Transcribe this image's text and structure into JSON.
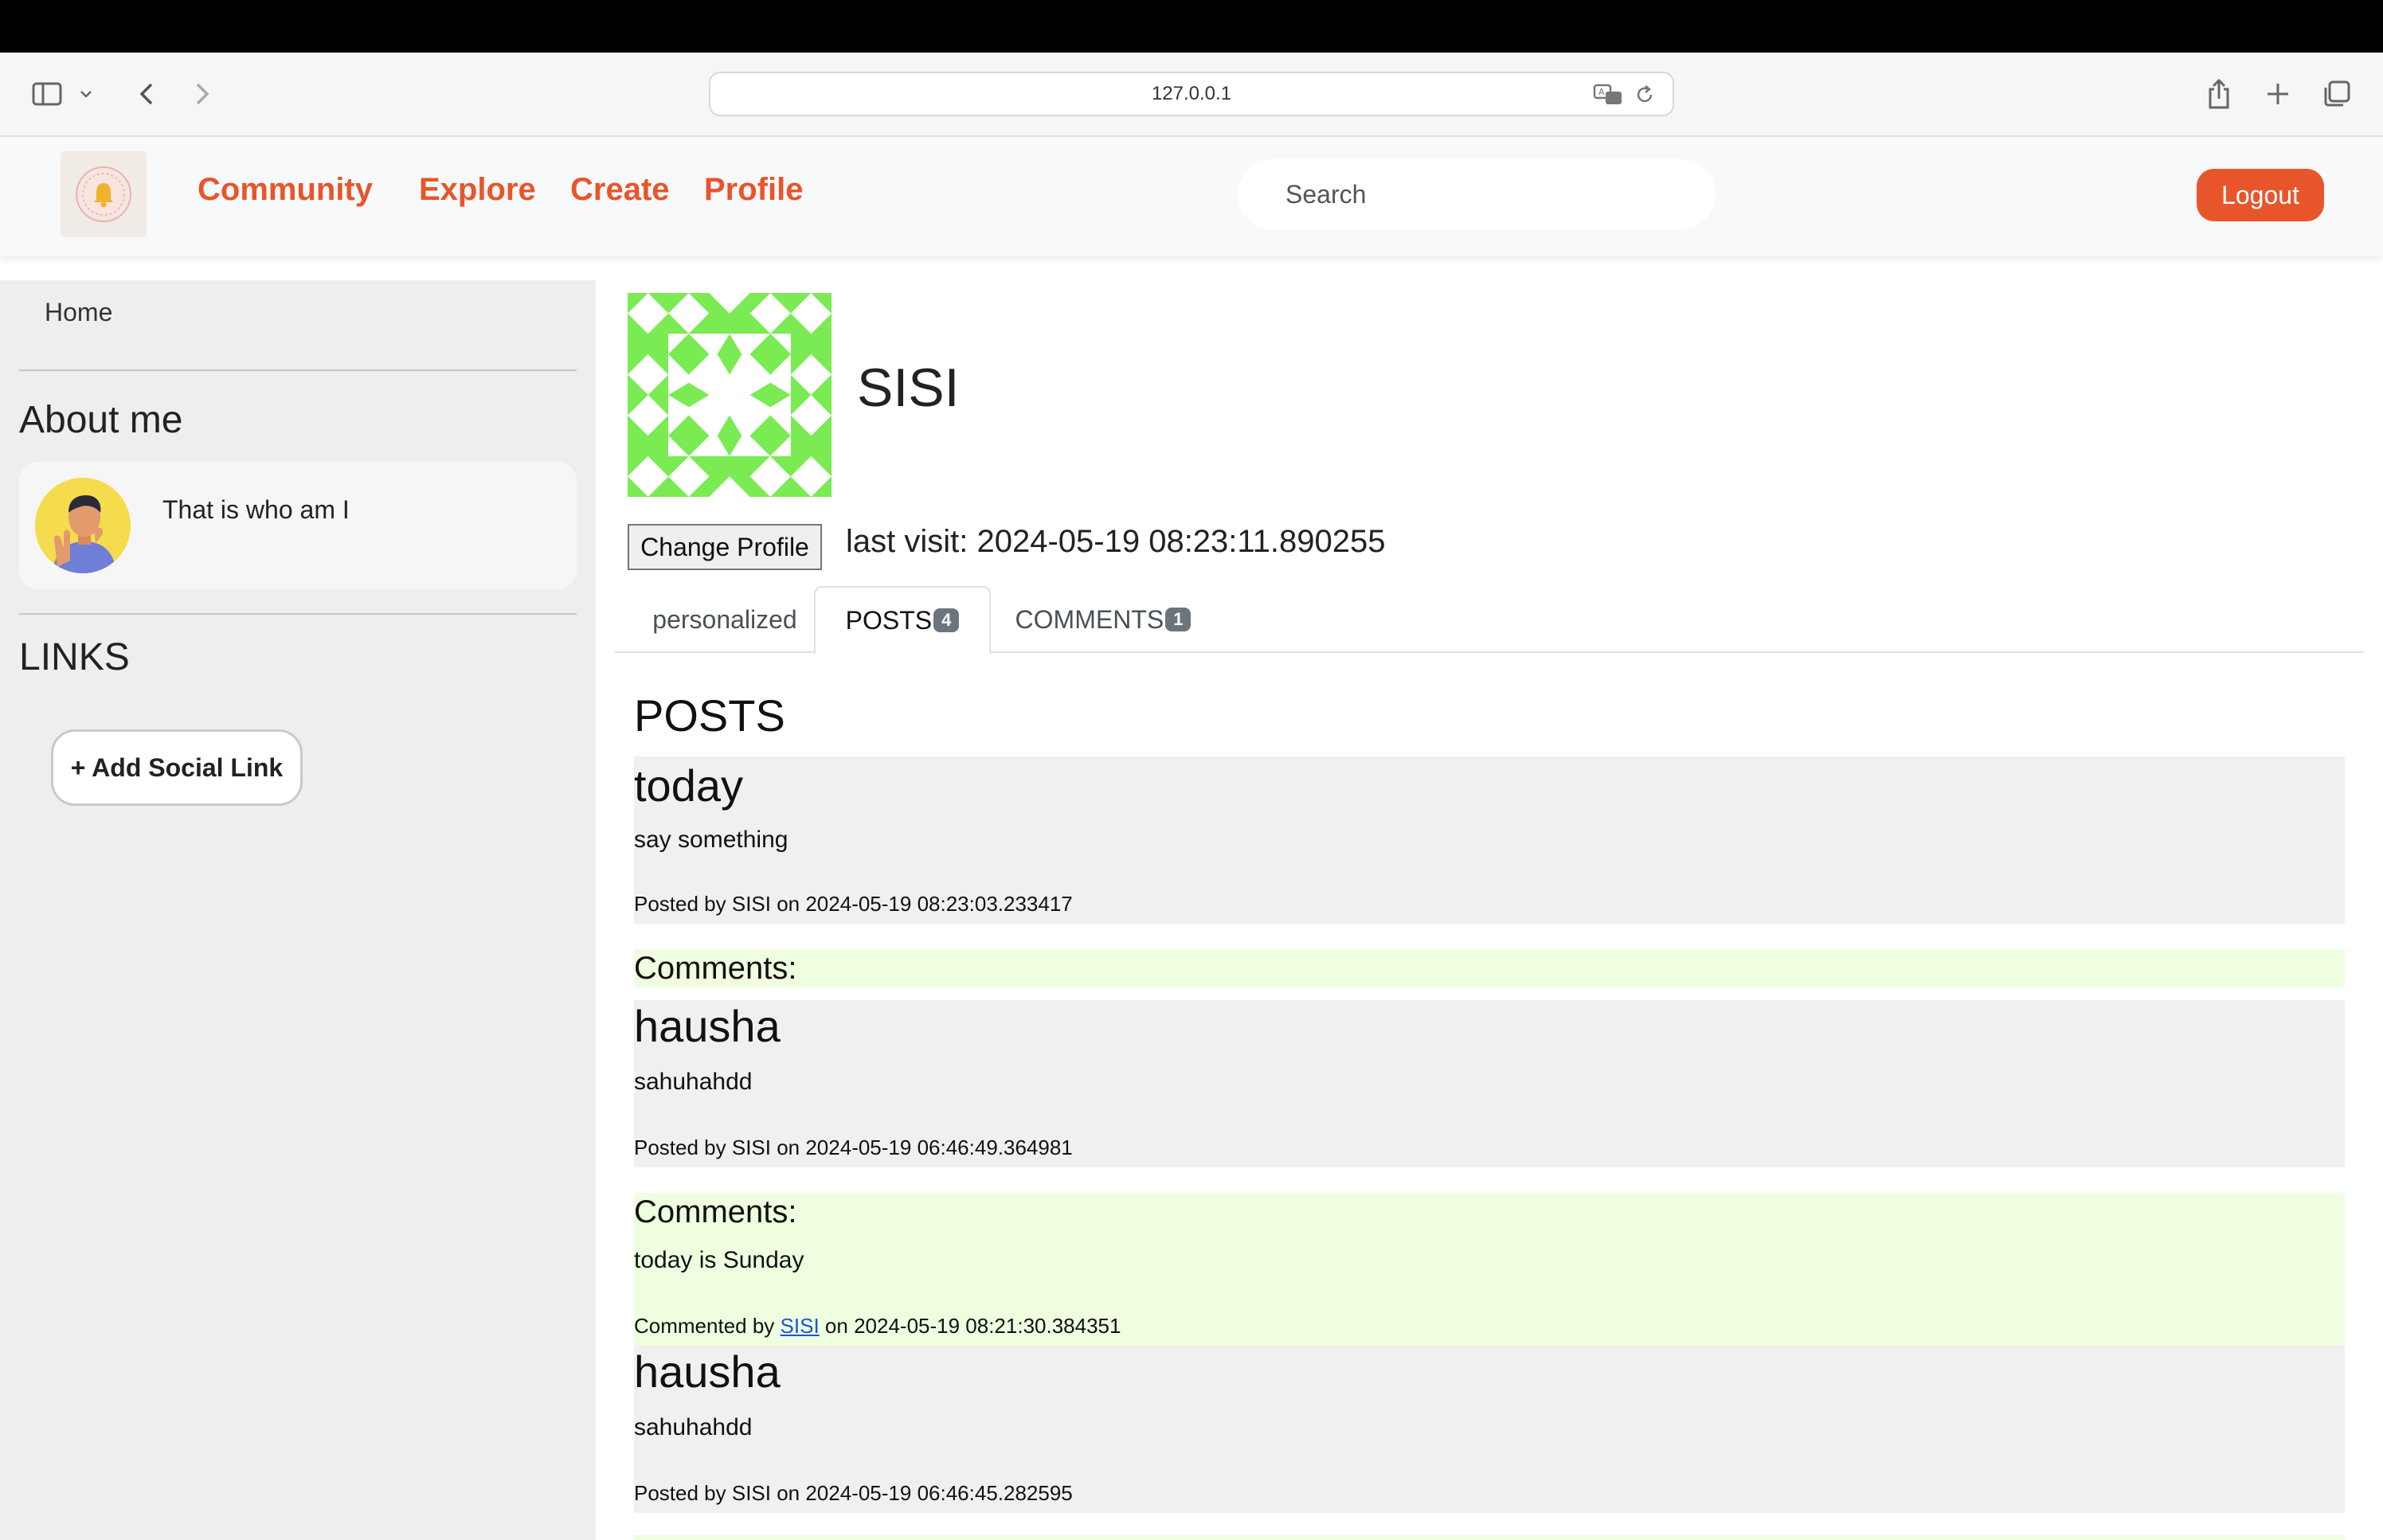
{
  "browser": {
    "url": "127.0.0.1"
  },
  "navbar": {
    "links": [
      "Community",
      "Explore",
      "Create",
      "Profile"
    ],
    "search_placeholder": "Search",
    "logout_label": "Logout",
    "accent_color": "#e8552a"
  },
  "sidebar": {
    "home_label": "Home",
    "about_heading": "About me",
    "about_text": "That is who am I",
    "links_heading": "LINKS",
    "add_link_label": "+ Add Social Link"
  },
  "profile": {
    "username": "SISI",
    "change_profile_label": "Change Profile",
    "last_visit": "last visit: 2024-05-19 08:23:11.890255",
    "identicon_color": "#7aeb52"
  },
  "tabs": [
    {
      "label": "personalized",
      "badge": ""
    },
    {
      "label": "POSTS",
      "badge": "4"
    },
    {
      "label": "COMMENTS",
      "badge": "1"
    }
  ],
  "posts_heading": "POSTS",
  "posts": [
    {
      "title": "today",
      "body": "say something",
      "meta": "Posted by SISI on 2024-05-19 08:23:03.233417",
      "comments_label": "Comments:"
    },
    {
      "title": "hausha",
      "body": "sahuhahdd",
      "meta": "Posted by SISI on 2024-05-19 06:46:49.364981",
      "comments_label": "Comments:",
      "comment": {
        "body": "today is Sunday",
        "prefix": "Commented by",
        "user": "SISI",
        "suffix": "on 2024-05-19 08:21:30.384351"
      }
    },
    {
      "title": "hausha",
      "body": "sahuhahdd",
      "meta": "Posted by SISI on 2024-05-19 06:46:45.282595"
    }
  ]
}
